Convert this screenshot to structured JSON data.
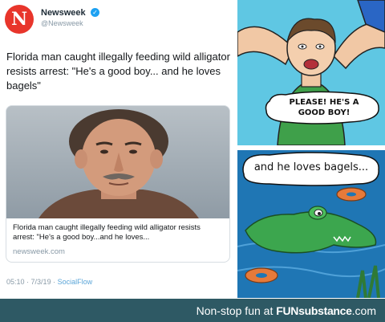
{
  "tweet": {
    "account_name": "Newsweek",
    "handle": "@Newsweek",
    "logo_letter": "N",
    "text": "Florida man caught illegally feeding wild alligator resists arrest: \"He's a good boy... and he loves bagels\"",
    "card": {
      "title": "Florida man caught illegally feeding wild alligator resists arrest: \"He's a good boy...and he loves...",
      "domain": "newsweek.com"
    },
    "time": "05:10",
    "date": "7/3/19",
    "source": "SocialFlow"
  },
  "comic": {
    "top_bubble": "PLEASE! HE'S A GOOD BOY!",
    "bottom_bubble": "and he loves bagels..."
  },
  "footer": {
    "prefix": "Non-stop fun at ",
    "brand": "FUNsubstance",
    "suffix": ".com"
  },
  "colors": {
    "newsweek_red": "#e8352b",
    "footer_bg": "#2e5964",
    "water": "#1f76b4",
    "sky": "#5fc7e3"
  }
}
